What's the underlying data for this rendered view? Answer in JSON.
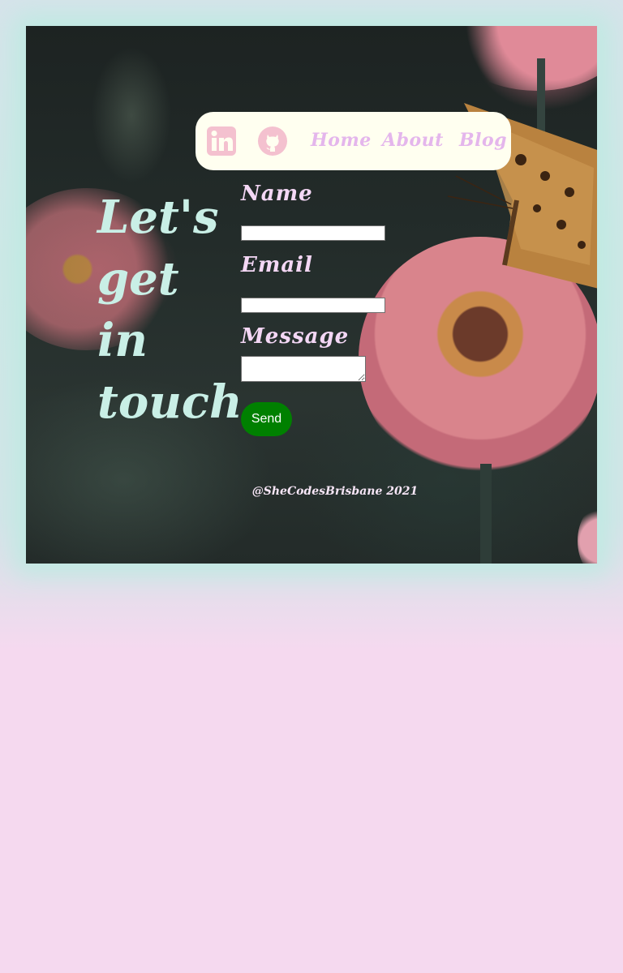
{
  "nav": {
    "icons": [
      "linkedin-icon",
      "github-icon"
    ],
    "links": [
      "Home",
      "About",
      "Blog"
    ],
    "link_color": "#e4b6ec",
    "icon_color": "#f4c1cf",
    "background": "#fffff0"
  },
  "heading": {
    "line1": "Let's",
    "line2": "get",
    "line3": "in",
    "line4": "touch",
    "color": "#c9efe6"
  },
  "form": {
    "name_label": "Name",
    "name_value": "",
    "email_label": "Email",
    "email_value": "",
    "message_label": "Message",
    "message_value": "",
    "send_label": "Send",
    "send_color": "#008000"
  },
  "footer": {
    "text": "@SheCodesBrisbane 2021"
  },
  "colors": {
    "page_background": "#f5d9ef",
    "card_glow": "#bfeae2",
    "label_color": "#f4d7f5"
  }
}
